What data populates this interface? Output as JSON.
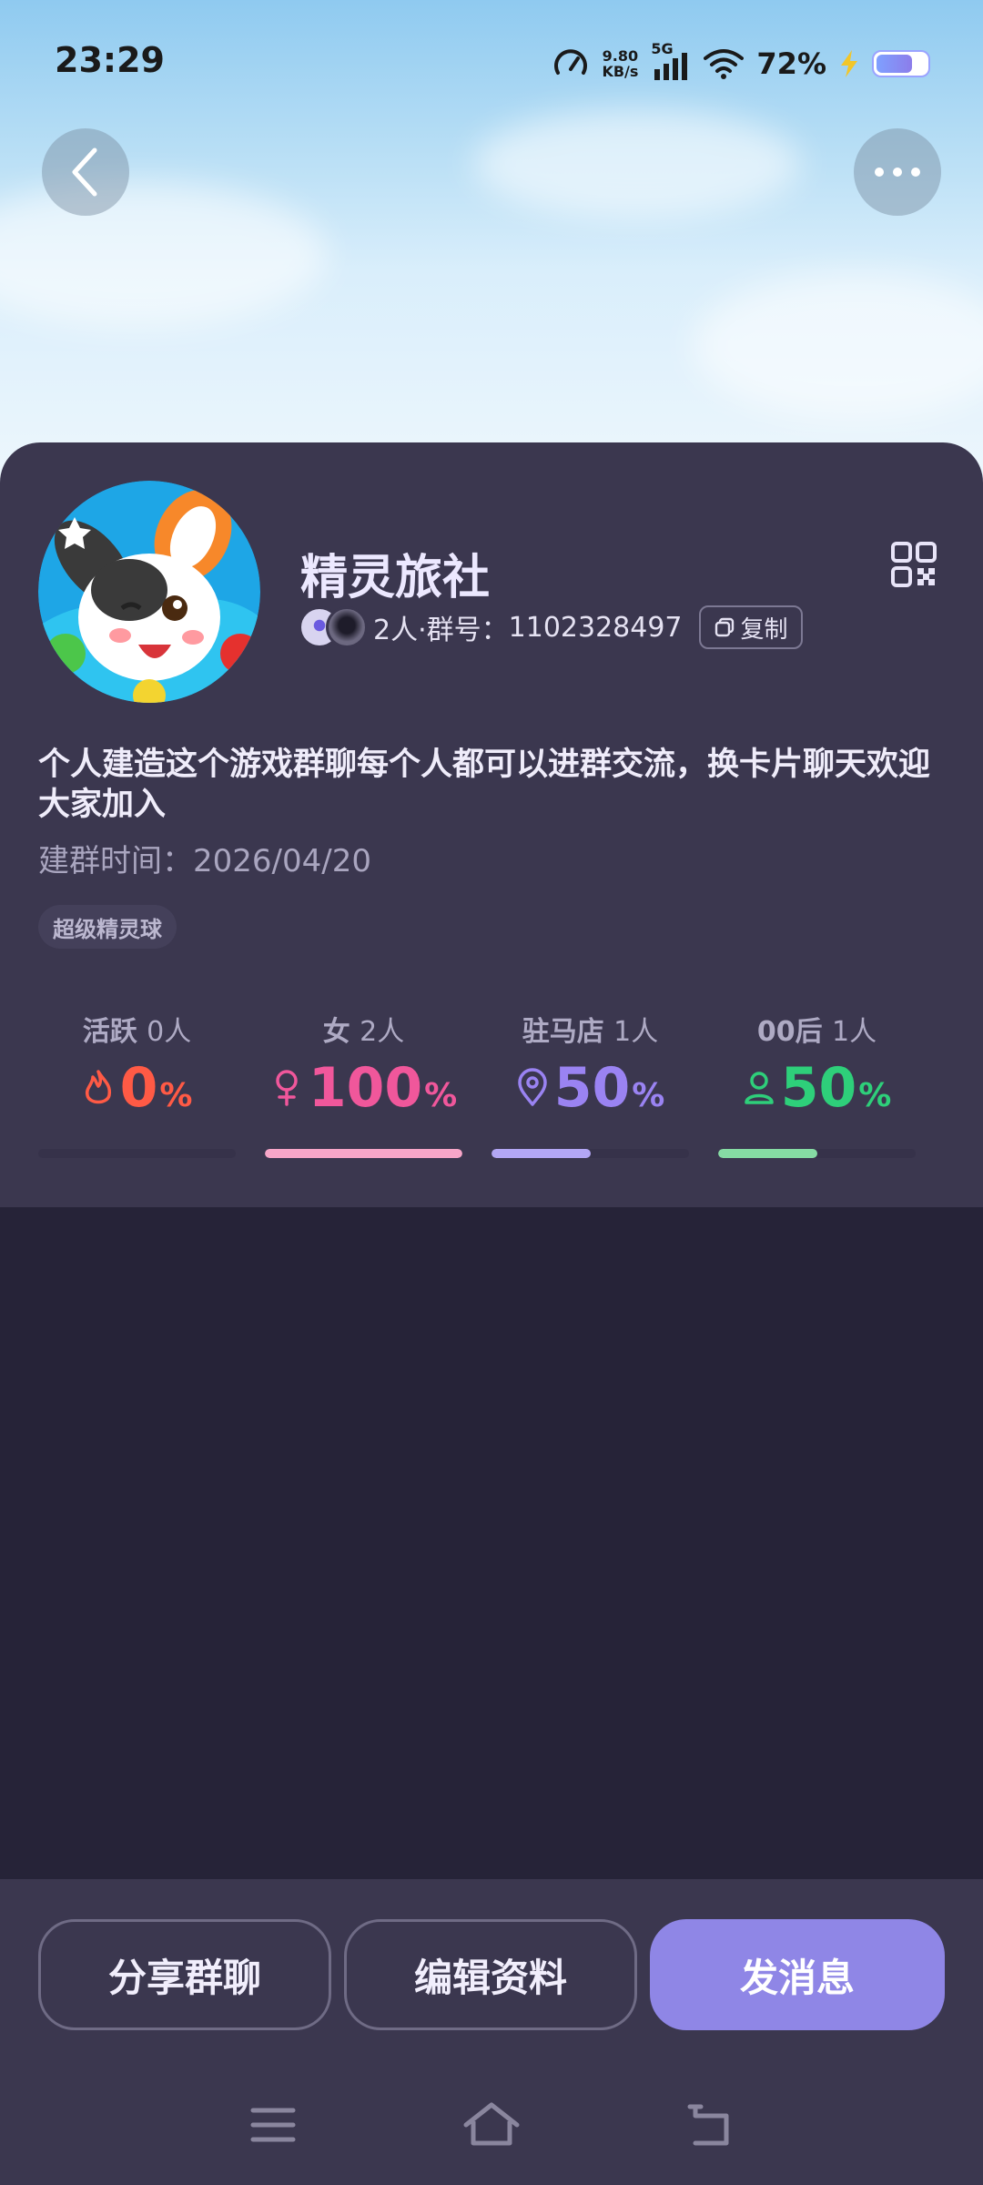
{
  "status_bar": {
    "time": "23:29",
    "net_speed_value": "9.80",
    "net_speed_unit": "KB/s",
    "network_type": "5G",
    "battery_percent": "72%",
    "battery_level": 0.72
  },
  "group": {
    "name": "精灵旅社",
    "member_count": "2人",
    "group_id_label": "·群号：",
    "group_id": "1102328497",
    "copy_label": "复制",
    "description": "个人建造这个游戏群聊每个人都可以进群交流，换卡片聊天欢迎大家加入",
    "created_label": "建群时间：",
    "created_date": "2026/04/20",
    "tag": "超级精灵球"
  },
  "stats": [
    {
      "label": "活跃",
      "count": "0人",
      "value": "0",
      "unit": "%",
      "fraction": 0.0,
      "icon": "flame-icon",
      "color": "#ff5a45",
      "bar_color": "#ff5a45"
    },
    {
      "label": "女",
      "count": "2人",
      "value": "100",
      "unit": "%",
      "fraction": 1.0,
      "icon": "female-icon",
      "color": "#f0579b",
      "bar_color": "#f7a6c8"
    },
    {
      "label": "驻马店",
      "count": "1人",
      "value": "50",
      "unit": "%",
      "fraction": 0.5,
      "icon": "location-pin-icon",
      "color": "#9a83f2",
      "bar_color": "#b3a7f5"
    },
    {
      "label": "00后",
      "count": "1人",
      "value": "50",
      "unit": "%",
      "fraction": 0.5,
      "icon": "person-icon",
      "color": "#2ecf7a",
      "bar_color": "#86dca4"
    }
  ],
  "actions": {
    "share_label": "分享群聊",
    "edit_label": "编辑资料",
    "message_label": "发消息"
  },
  "colors": {
    "accent": "#8f86e6",
    "card_bg": "#3b374f",
    "page_bg": "#262338"
  }
}
